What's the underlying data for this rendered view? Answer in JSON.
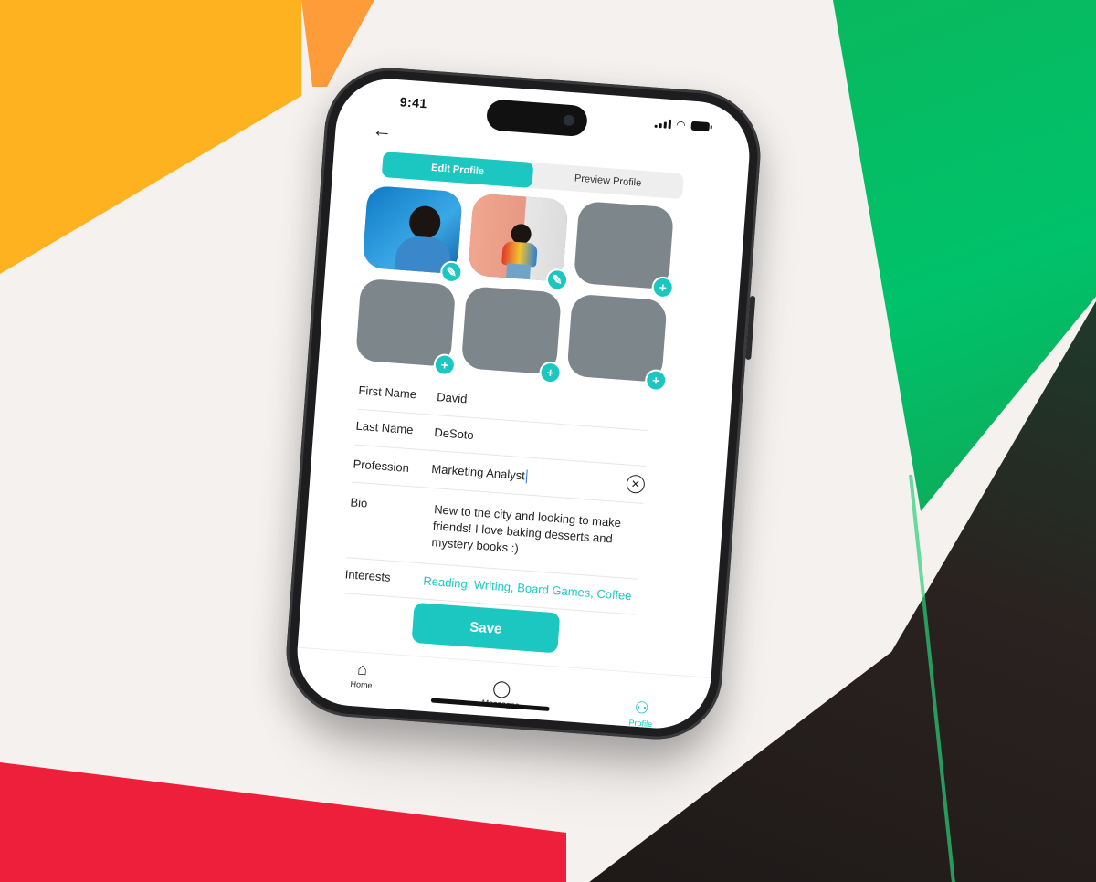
{
  "status_bar": {
    "time": "9:41"
  },
  "nav": {
    "back_icon": "arrow-left-icon"
  },
  "segmented": {
    "edit_label": "Edit Profile",
    "preview_label": "Preview Profile",
    "active": "edit"
  },
  "photos": [
    {
      "filled": true,
      "action": "pencil-icon",
      "action_glyph": "✎"
    },
    {
      "filled": true,
      "action": "pencil-icon",
      "action_glyph": "✎"
    },
    {
      "filled": false,
      "action": "plus-icon",
      "action_glyph": "+"
    },
    {
      "filled": false,
      "action": "plus-icon",
      "action_glyph": "+"
    },
    {
      "filled": false,
      "action": "plus-icon",
      "action_glyph": "+"
    },
    {
      "filled": false,
      "action": "plus-icon",
      "action_glyph": "+"
    }
  ],
  "form": {
    "first_name": {
      "label": "First Name",
      "value": "David"
    },
    "last_name": {
      "label": "Last Name",
      "value": "DeSoto"
    },
    "profession": {
      "label": "Profession",
      "value": "Marketing Analyst"
    },
    "bio": {
      "label": "Bio",
      "value": "New to the city and looking to make friends! I love baking desserts and mystery books :)"
    },
    "interests": {
      "label": "Interests",
      "value": "Reading, Writing, Board Games, Coffee"
    }
  },
  "save_label": "Save",
  "tabs": [
    {
      "label": "Home",
      "icon": "home-icon",
      "glyph": "⌂",
      "active": false
    },
    {
      "label": "Messages",
      "icon": "chat-bubble-icon",
      "glyph": "◯",
      "active": false
    },
    {
      "label": "Profile",
      "icon": "person-icon",
      "glyph": "⚇",
      "active": true
    }
  ],
  "colors": {
    "accent": "#1cc7c1",
    "placeholder_tile": "#7d878b"
  }
}
